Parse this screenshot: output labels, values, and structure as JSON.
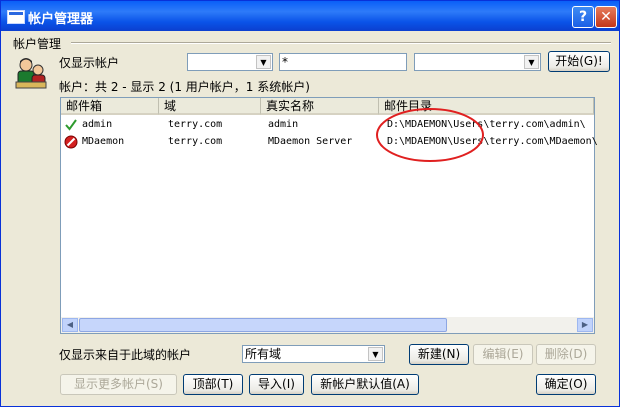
{
  "window": {
    "title": "帐户管理器",
    "help": "?",
    "close": "✕"
  },
  "group": {
    "label": "帐户管理"
  },
  "filter": {
    "label": "仅显示帐户",
    "dropdown1_value": "",
    "text_value": "*",
    "dropdown2_value": "",
    "start_button": "开始(G)!"
  },
  "summary": "帐户：共 2 - 显示 2 (1 用户帐户，1 系统帐户)",
  "columns": [
    "邮件箱",
    "域",
    "真实名称",
    "邮件目录"
  ],
  "rows": [
    {
      "mailbox": "admin",
      "domain": "terry.com",
      "realname": "admin",
      "dir": "D:\\MDAEMON\\Users\\terry.com\\admin\\",
      "icon": "check-icon"
    },
    {
      "mailbox": "MDaemon",
      "domain": "terry.com",
      "realname": "MDaemon Server",
      "dir": "D:\\MDAEMON\\Users\\terry.com\\MDaemon\\",
      "icon": "system-account-icon"
    }
  ],
  "domain_filter": {
    "label": "仅显示来自于此域的帐户",
    "value": "所有域"
  },
  "buttons": {
    "new": "新建(N)",
    "edit": "编辑(E)",
    "delete": "删除(D)",
    "show_more": "显示更多帐户(S)",
    "top": "顶部(T)",
    "import": "导入(I)",
    "defaults": "新帐户默认值(A)",
    "ok": "确定(O)"
  },
  "colors": {
    "title_bar": "#0A5FF7",
    "annotation_circle": "#E02020",
    "face": "#ECE9D8"
  }
}
